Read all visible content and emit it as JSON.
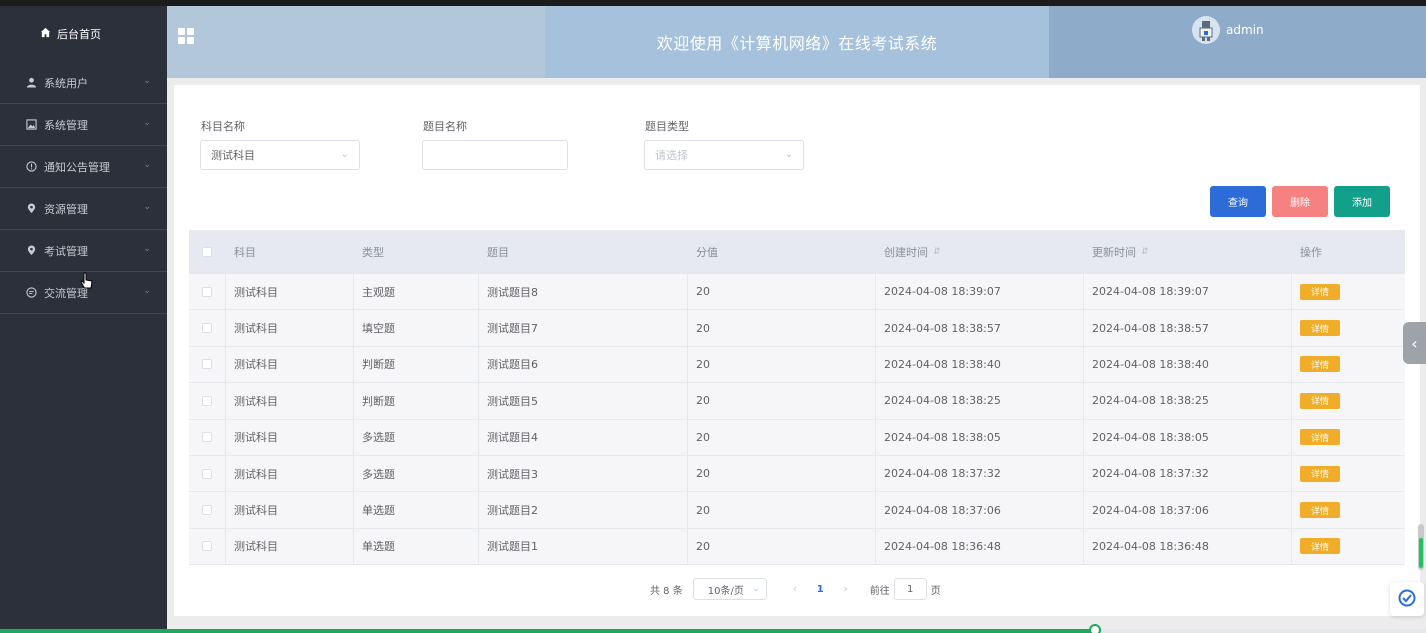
{
  "colors": {
    "sidebar_bg": "#2b303b",
    "accent_blue": "#2d6bd8",
    "delete_red": "#f56c6c",
    "add_teal": "#13a08b",
    "detail_orange": "#f0ad2a",
    "progress_green": "#1ca95d"
  },
  "sidebar": {
    "home": {
      "icon": "home-icon",
      "label": "后台首页"
    },
    "items": [
      {
        "icon": "user-icon",
        "label": "系统用户"
      },
      {
        "icon": "picture-icon",
        "label": "系统管理"
      },
      {
        "icon": "info-icon",
        "label": "通知公告管理"
      },
      {
        "icon": "location-icon",
        "label": "资源管理"
      },
      {
        "icon": "location-icon",
        "label": "考试管理"
      },
      {
        "icon": "chat-icon",
        "label": "交流管理"
      }
    ]
  },
  "header": {
    "title": "欢迎使用《计算机网络》在线考试系统",
    "username": "admin"
  },
  "filters": {
    "subject": {
      "label": "科目名称",
      "value": "测试科目"
    },
    "title": {
      "label": "题目名称",
      "value": ""
    },
    "type": {
      "label": "题目类型",
      "placeholder": "请选择"
    }
  },
  "buttons": {
    "query": "查询",
    "delete": "删除",
    "add": "添加"
  },
  "table": {
    "columns": [
      "科目",
      "类型",
      "题目",
      "分值",
      "创建时间",
      "更新时间",
      "操作"
    ],
    "action_label": "详情",
    "rows": [
      {
        "subject": "测试科目",
        "type": "主观题",
        "title": "测试题目8",
        "score": "20",
        "created": "2024-04-08 18:39:07",
        "updated": "2024-04-08 18:39:07"
      },
      {
        "subject": "测试科目",
        "type": "填空题",
        "title": "测试题目7",
        "score": "20",
        "created": "2024-04-08 18:38:57",
        "updated": "2024-04-08 18:38:57"
      },
      {
        "subject": "测试科目",
        "type": "判断题",
        "title": "测试题目6",
        "score": "20",
        "created": "2024-04-08 18:38:40",
        "updated": "2024-04-08 18:38:40"
      },
      {
        "subject": "测试科目",
        "type": "判断题",
        "title": "测试题目5",
        "score": "20",
        "created": "2024-04-08 18:38:25",
        "updated": "2024-04-08 18:38:25"
      },
      {
        "subject": "测试科目",
        "type": "多选题",
        "title": "测试题目4",
        "score": "20",
        "created": "2024-04-08 18:38:05",
        "updated": "2024-04-08 18:38:05"
      },
      {
        "subject": "测试科目",
        "type": "多选题",
        "title": "测试题目3",
        "score": "20",
        "created": "2024-04-08 18:37:32",
        "updated": "2024-04-08 18:37:32"
      },
      {
        "subject": "测试科目",
        "type": "单选题",
        "title": "测试题目2",
        "score": "20",
        "created": "2024-04-08 18:37:06",
        "updated": "2024-04-08 18:37:06"
      },
      {
        "subject": "测试科目",
        "type": "单选题",
        "title": "测试题目1",
        "score": "20",
        "created": "2024-04-08 18:36:48",
        "updated": "2024-04-08 18:36:48"
      }
    ]
  },
  "pagination": {
    "total": "共 8 条",
    "page_size": "10条/页",
    "current_page": "1",
    "goto_prefix": "前往",
    "goto_value": "1",
    "goto_suffix": "页"
  },
  "page_progress": 0.737
}
